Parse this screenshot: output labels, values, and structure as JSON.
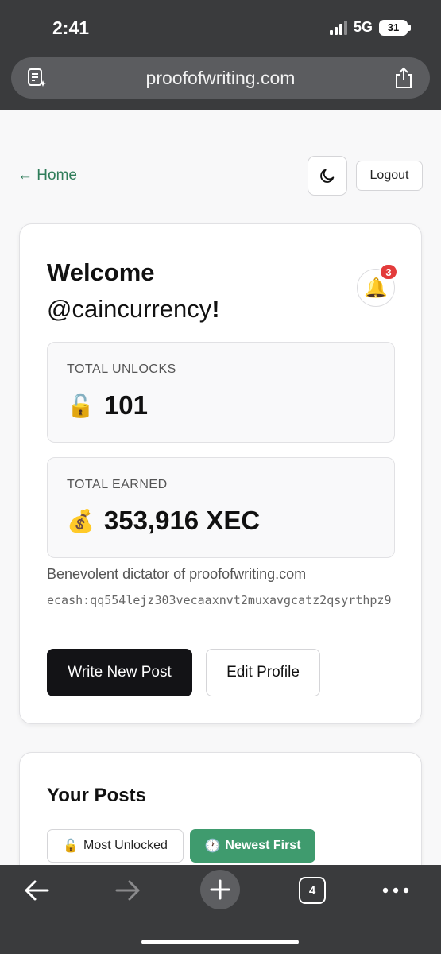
{
  "status_bar": {
    "time": "2:41",
    "network": "5G",
    "battery": "31"
  },
  "browser": {
    "url": "proofofwriting.com",
    "tab_count": "4",
    "icons": {
      "reader": "reader-icon",
      "share": "share-icon",
      "back": "back-arrow-icon",
      "forward": "forward-arrow-icon",
      "new_tab": "plus-icon",
      "tabs": "tabs-icon",
      "more": "more-icon"
    }
  },
  "nav": {
    "home_label": "← Home",
    "logout_label": "Logout",
    "theme_icon": "moon-icon"
  },
  "welcome": {
    "title": "Welcome",
    "handle": "@caincurrency",
    "exclaim": "!",
    "notification_count": "3",
    "bell_emoji": "🔔"
  },
  "stats": [
    {
      "label": "TOTAL UNLOCKS",
      "emoji": "🔓",
      "value": "101"
    },
    {
      "label": "TOTAL EARNED",
      "emoji": "💰",
      "value": "353,916 XEC"
    }
  ],
  "profile": {
    "bio": "Benevolent dictator of proofofwriting.com",
    "address": "ecash:qq554lejz303vecaaxnvt2muxavgcatz2qsyrthpz9"
  },
  "actions": {
    "write_label": "Write New Post",
    "edit_label": "Edit Profile"
  },
  "posts": {
    "title": "Your Posts",
    "sort_unlocked_emoji": "🔓",
    "sort_unlocked_label": "Most Unlocked",
    "sort_newest_emoji": "🕐",
    "sort_newest_label": "Newest First"
  },
  "colors": {
    "accent_green": "#3f9b6e",
    "link_green": "#2f7d5a",
    "badge_red": "#e33b3b",
    "primary_dark": "#131316"
  }
}
